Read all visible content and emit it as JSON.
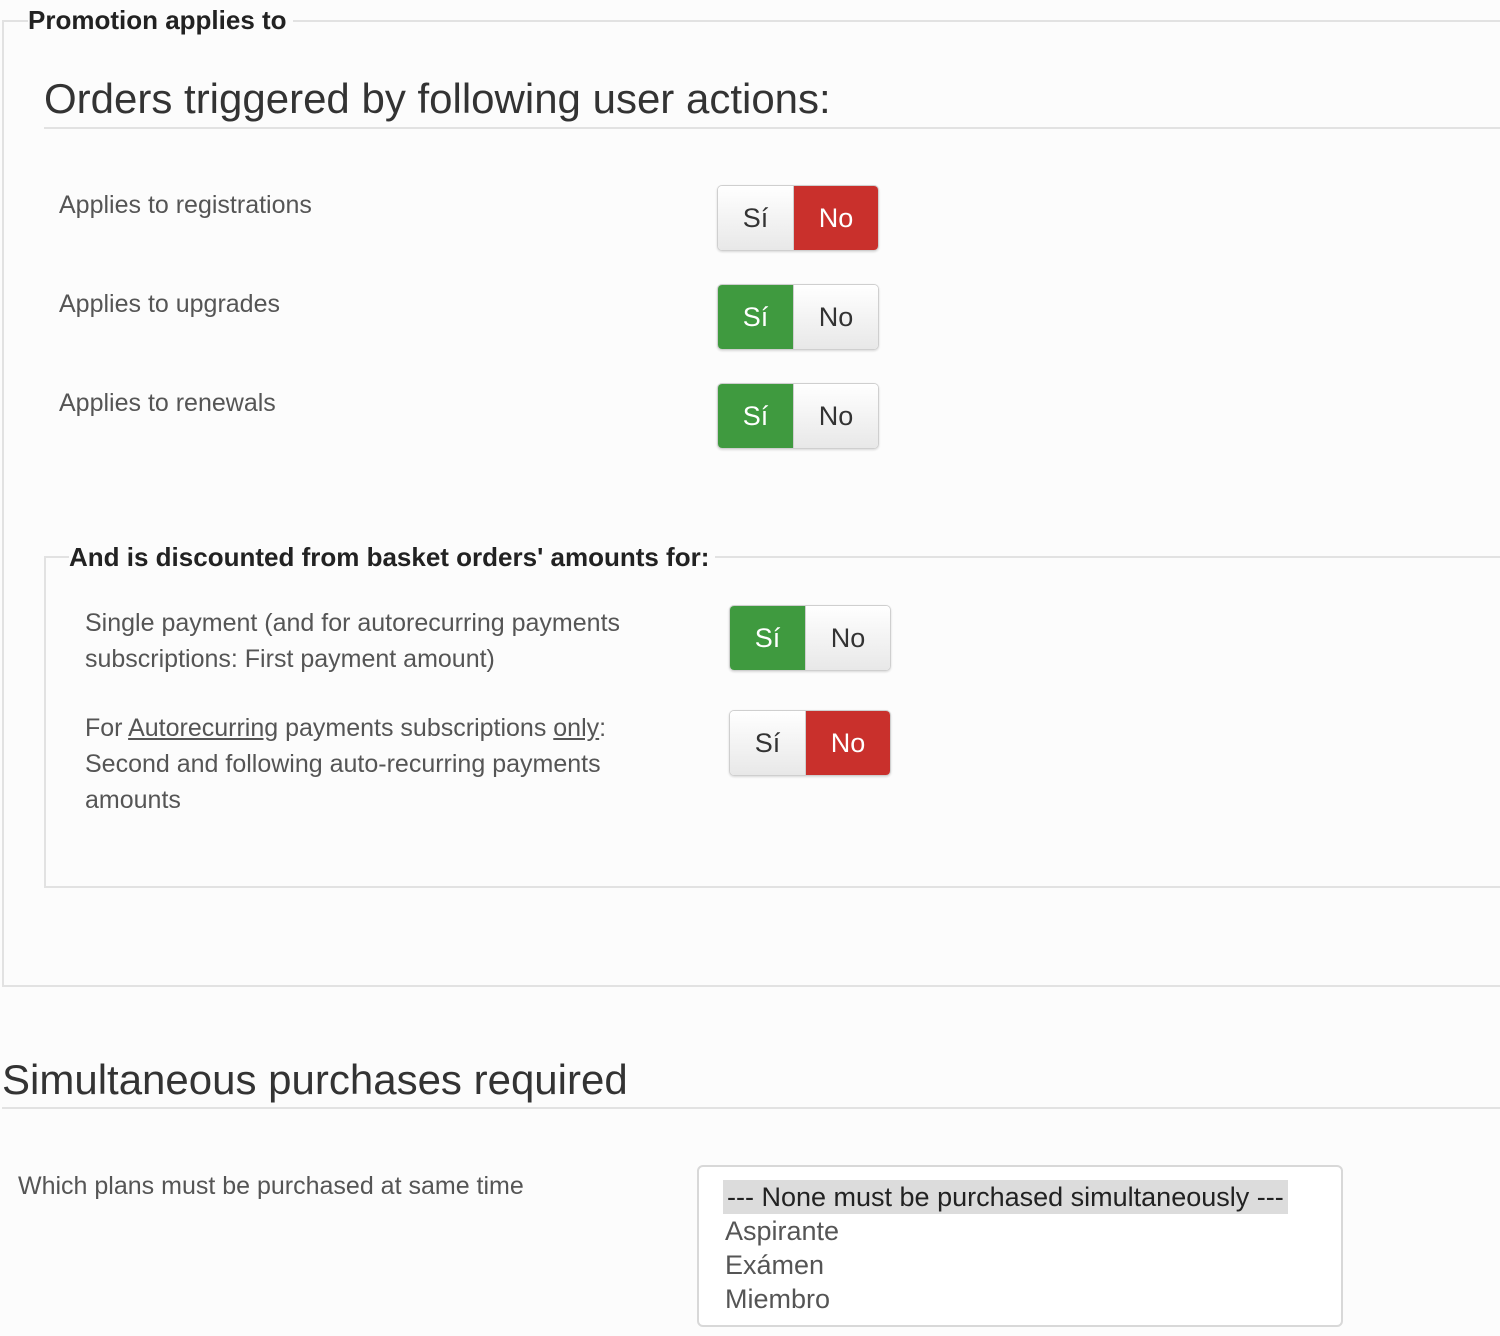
{
  "promotion": {
    "legend": "Promotion applies to",
    "heading": "Orders triggered by following user actions:",
    "rows": [
      {
        "label": "Applies to registrations",
        "yes": "Sí",
        "no": "No",
        "value": "No"
      },
      {
        "label": "Applies to upgrades",
        "yes": "Sí",
        "no": "No",
        "value": "Sí"
      },
      {
        "label": "Applies to renewals",
        "yes": "Sí",
        "no": "No",
        "value": "Sí"
      }
    ]
  },
  "discount": {
    "legend": "And is discounted from basket orders' amounts for:",
    "single": {
      "label": "Single payment (and for autorecurring payments subscriptions: First payment amount)",
      "yes": "Sí",
      "no": "No",
      "value": "Sí"
    },
    "recurring": {
      "label_prefix": "For ",
      "label_link1": "Autorecurring",
      "label_mid": " payments subscriptions ",
      "label_link2": "only",
      "label_suffix": ": Second and following auto-recurring payments amounts",
      "yes": "Sí",
      "no": "No",
      "value": "No"
    }
  },
  "simultaneous": {
    "heading": "Simultaneous purchases required",
    "label": "Which plans must be purchased at same time",
    "options": [
      "--- None must be purchased simultaneously ---",
      "Aspirante",
      "Exámen",
      "Miembro"
    ],
    "selected": "--- None must be purchased simultaneously ---"
  },
  "colors": {
    "yes_active": "#3f9a3f",
    "no_active": "#c9302c"
  }
}
